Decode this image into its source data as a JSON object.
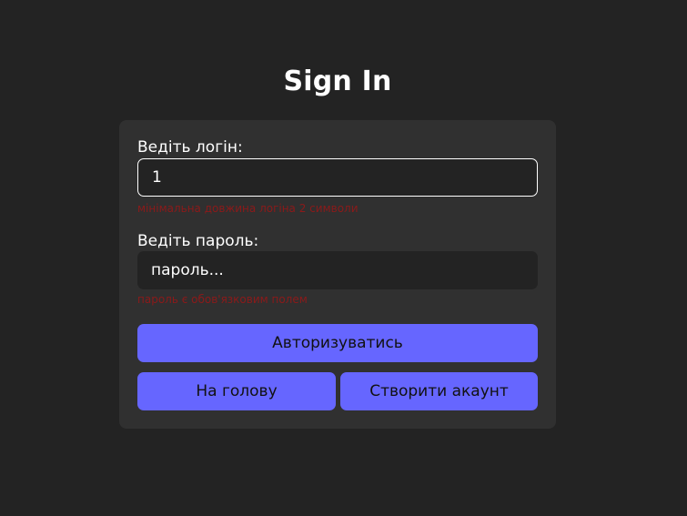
{
  "title": "Sign In",
  "form": {
    "login_label": "Ведіть логін:",
    "login_value": "1",
    "login_error": "мінімальна довжина логіна 2 символи",
    "password_label": "Ведіть пароль:",
    "password_placeholder": "пароль...",
    "password_error": "пароль є обов'язковим полем"
  },
  "buttons": {
    "login": "Авторизуватись",
    "home": "На голову",
    "create_account": "Створити акаунт"
  },
  "colors": {
    "background": "#232323",
    "card": "#303030",
    "accent": "#6666ff",
    "error": "#8b1a1a"
  }
}
